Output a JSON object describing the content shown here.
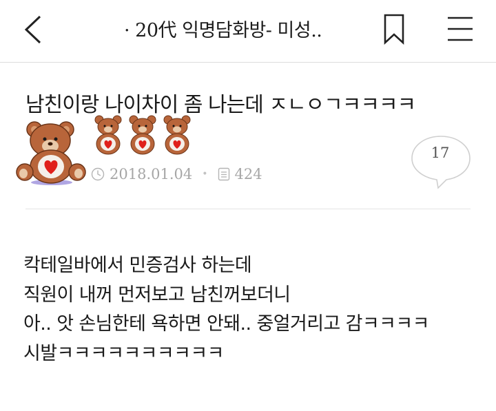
{
  "header": {
    "title": "· 20代 익명담화방- 미성..",
    "icons": {
      "back": "back-chevron-icon",
      "bookmark": "bookmark-icon",
      "menu": "hamburger-menu-icon"
    }
  },
  "post": {
    "title": "남친이랑 나이차이 좀 나는데 ㅈㄴㅇㄱㅋㅋㅋㅋ",
    "date": "2018.01.04",
    "views": "424",
    "comment_count": "17",
    "icons": {
      "date": "clock-icon",
      "views": "document-icon",
      "comments": "speech-bubble-icon",
      "avatar": "teddy-bear-avatar",
      "badges": "teddy-bear-badge"
    },
    "body_lines": [
      "칵테일바에서 민증검사 하는데",
      "직원이 내꺼 먼저보고 남친꺼보더니",
      "아.. 앗 손님한테 욕하면 안돼.. 중얼거리고 감ㅋㅋㅋㅋ",
      "시발ㅋㅋㅋㅋㅋㅋㅋㅋㅋㅋ"
    ]
  },
  "colors": {
    "meta_text": "#a6a6a6",
    "bear_brown": "#b8653a",
    "heart_red": "#e0201b"
  }
}
